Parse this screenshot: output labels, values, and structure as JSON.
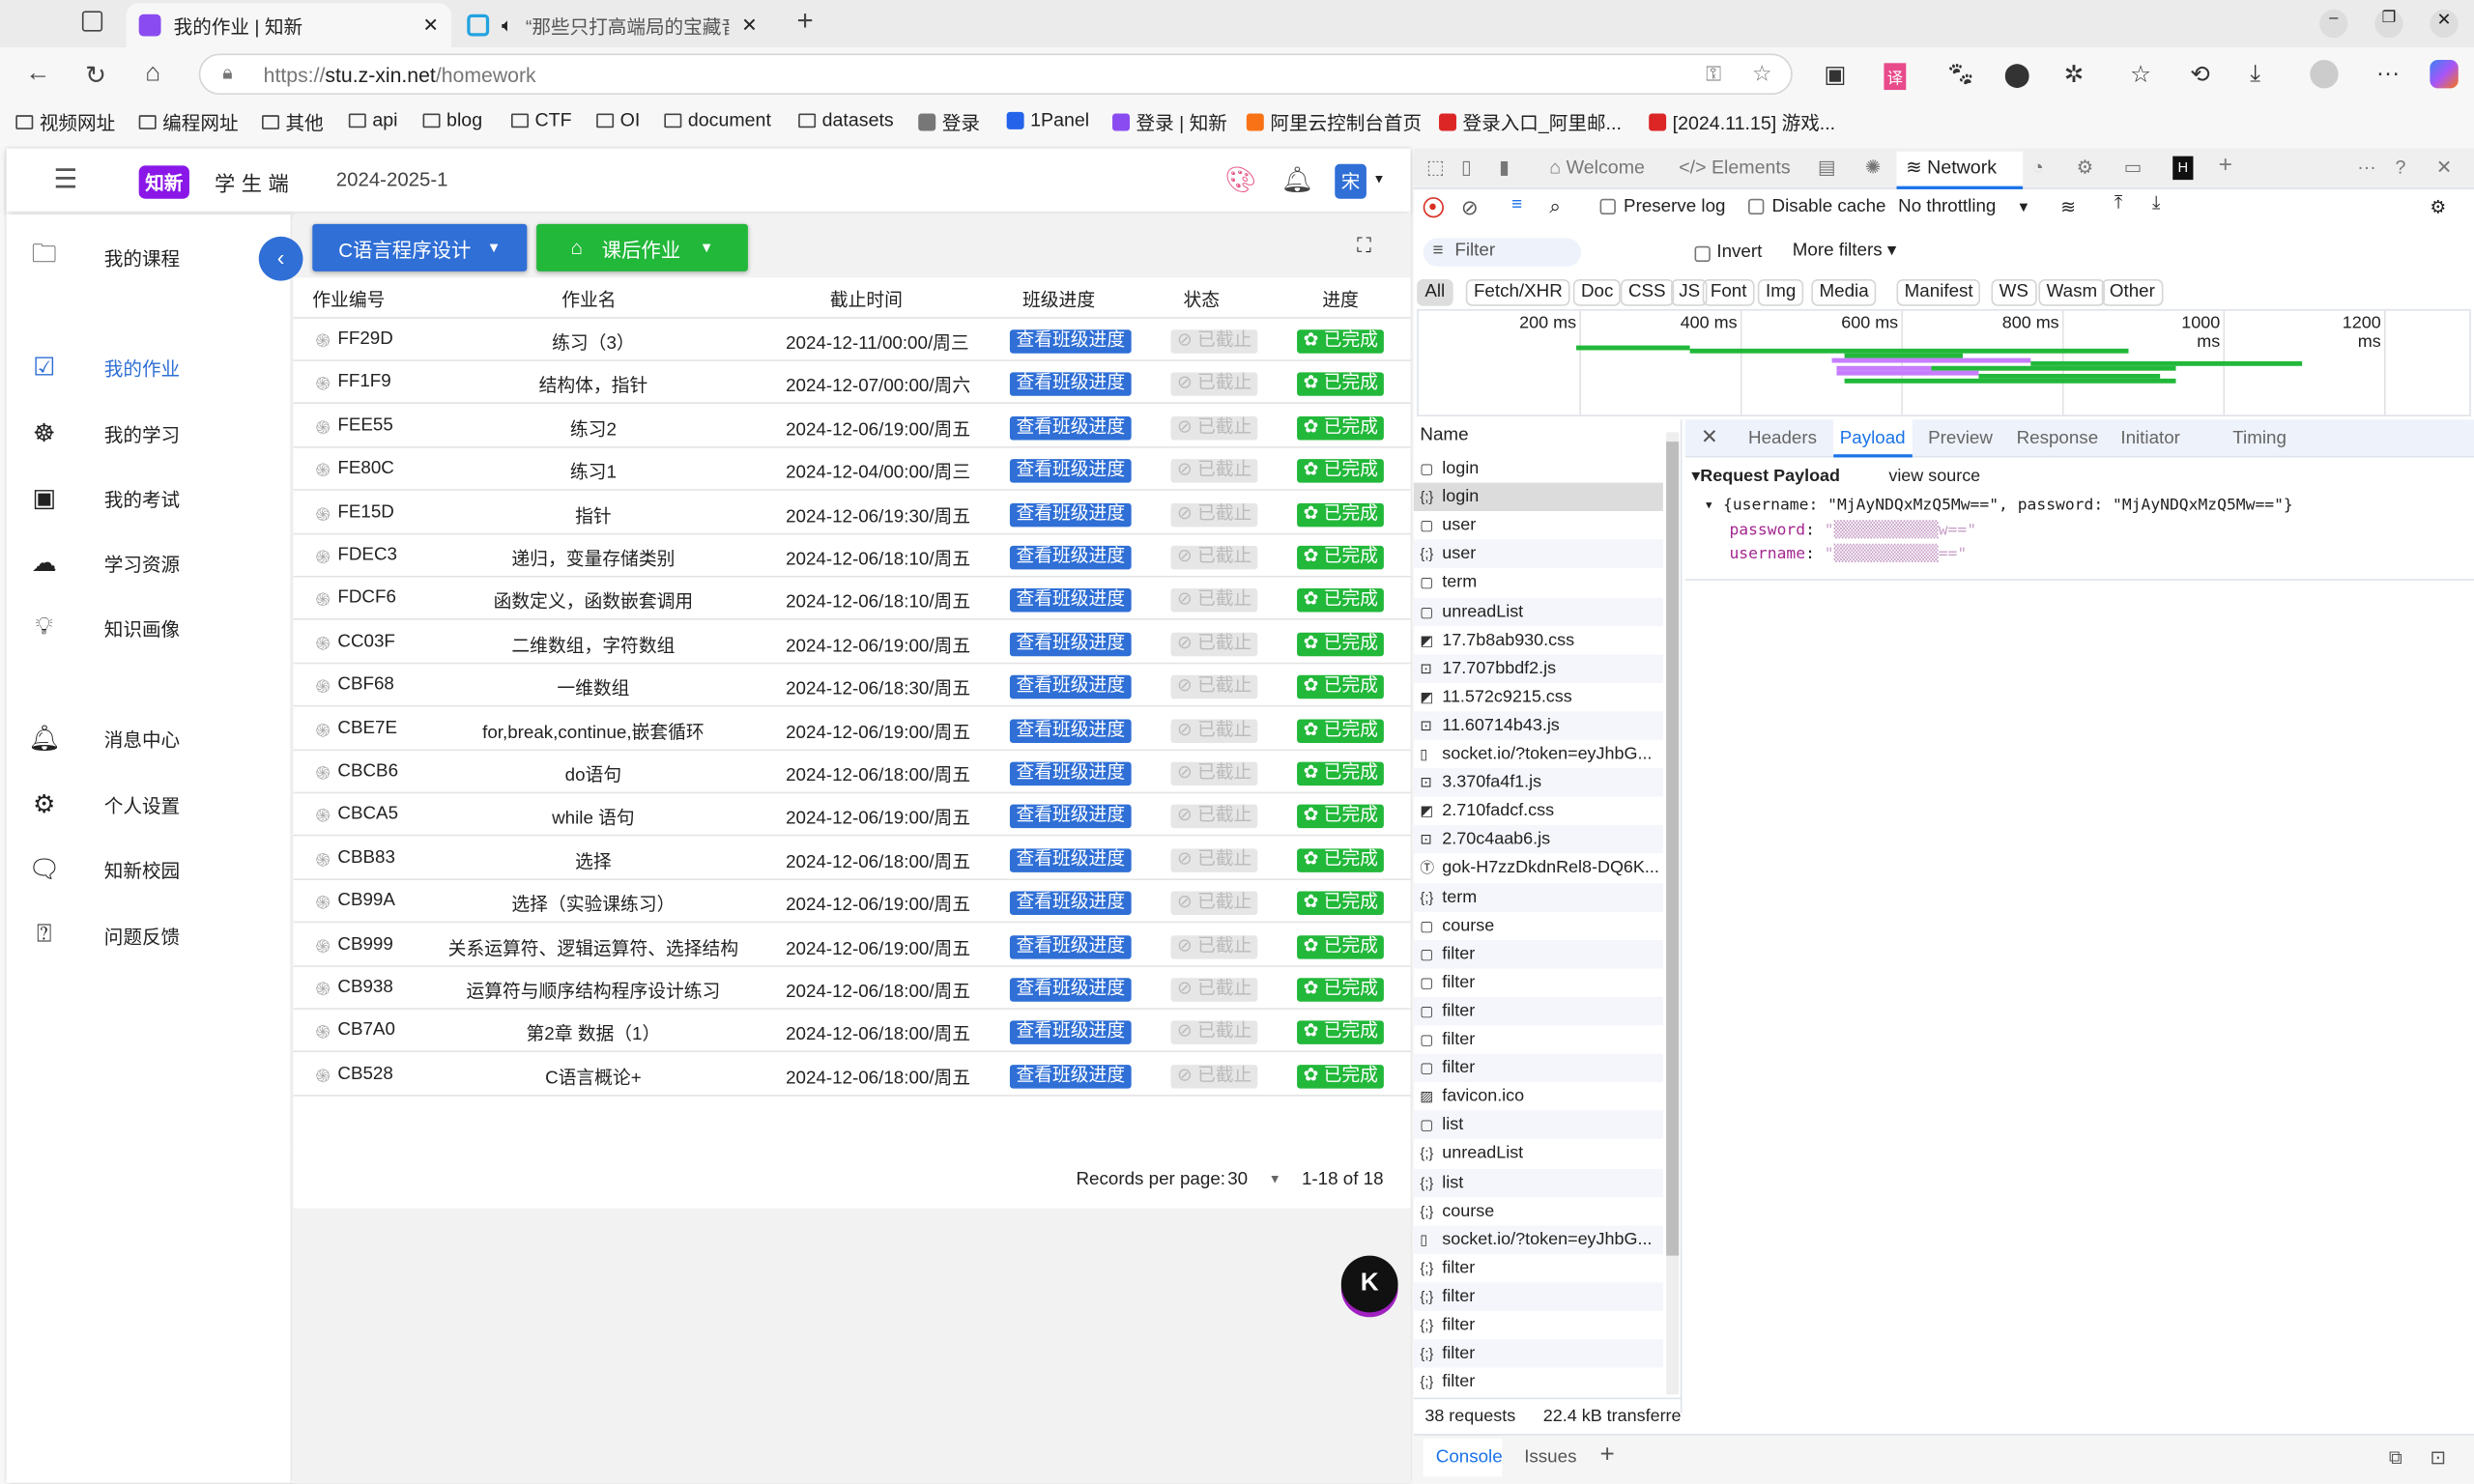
{
  "browser": {
    "tabs": [
      {
        "title": "我的作业 | 知新",
        "active": true
      },
      {
        "title": "“那些只打高端局的宝藏音",
        "active": false
      }
    ],
    "url_scheme": "https://",
    "url_host": "stu.z-xin.net",
    "url_path": "/homework",
    "bookmarks": [
      "视频网址",
      "编程网址",
      "其他",
      "api",
      "blog",
      "CTF",
      "OI",
      "document",
      "datasets",
      "登录",
      "1Panel",
      "登录 | 知新",
      "阿里云控制台首页",
      "登录入口_阿里邮...",
      "[2024.11.15] 游戏..."
    ]
  },
  "app": {
    "logo": "知新",
    "subtitle": "学生端",
    "term": "2024-2025-1",
    "avatar": "宋",
    "sidebar": [
      {
        "label": "我的课程",
        "icon": "folder-user-icon"
      },
      {
        "label": "我的作业",
        "icon": "checklist-icon",
        "selected": true
      },
      {
        "label": "我的学习",
        "icon": "brain-icon"
      },
      {
        "label": "我的考试",
        "icon": "exam-icon"
      },
      {
        "label": "学习资源",
        "icon": "cloud-icon"
      },
      {
        "label": "知识画像",
        "icon": "lightbulb-icon"
      },
      {
        "label": "消息中心",
        "icon": "bell-icon"
      },
      {
        "label": "个人设置",
        "icon": "gear-icon"
      },
      {
        "label": "知新校园",
        "icon": "chat-icon"
      },
      {
        "label": "问题反馈",
        "icon": "question-icon"
      }
    ],
    "course_select": "C语言程序设计",
    "type_select": "课后作业",
    "columns": [
      "作业编号",
      "作业名",
      "截止时间",
      "班级进度",
      "状态",
      "进度"
    ],
    "view_progress_label": "查看班级进度",
    "status_label": "已截止",
    "progress_label": "已完成",
    "rows": [
      [
        "FF29D",
        "练习（3）",
        "2024-12-11/00:00/周三"
      ],
      [
        "FF1F9",
        "结构体，指针",
        "2024-12-07/00:00/周六"
      ],
      [
        "FEE55",
        "练习2",
        "2024-12-06/19:00/周五"
      ],
      [
        "FE80C",
        "练习1",
        "2024-12-04/00:00/周三"
      ],
      [
        "FE15D",
        "指针",
        "2024-12-06/19:30/周五"
      ],
      [
        "FDEC3",
        "递归，变量存储类别",
        "2024-12-06/18:10/周五"
      ],
      [
        "FDCF6",
        "函数定义，函数嵌套调用",
        "2024-12-06/18:10/周五"
      ],
      [
        "CC03F",
        "二维数组，字符数组",
        "2024-12-06/19:00/周五"
      ],
      [
        "CBF68",
        "一维数组",
        "2024-12-06/18:30/周五"
      ],
      [
        "CBE7E",
        "for,break,continue,嵌套循环",
        "2024-12-06/19:00/周五"
      ],
      [
        "CBCB6",
        "do语句",
        "2024-12-06/18:00/周五"
      ],
      [
        "CBCA5",
        "while 语句",
        "2024-12-06/19:00/周五"
      ],
      [
        "CBB83",
        "选择",
        "2024-12-06/18:00/周五"
      ],
      [
        "CB99A",
        "选择（实验课练习）",
        "2024-12-06/19:00/周五"
      ],
      [
        "CB999",
        "关系运算符、逻辑运算符、选择结构",
        "2024-12-06/19:00/周五"
      ],
      [
        "CB938",
        "运算符与顺序结构程序设计练习",
        "2024-12-06/18:00/周五"
      ],
      [
        "CB7A0",
        "第2章 数据（1）",
        "2024-12-06/18:00/周五"
      ],
      [
        "CB528",
        "C语言概论+",
        "2024-12-06/18:00/周五"
      ]
    ],
    "records_per_page_label": "Records per page:",
    "records_per_page": "30",
    "range": "1-18 of 18"
  },
  "devtools": {
    "tabs": [
      "Welcome",
      "Elements",
      "Network"
    ],
    "preserve_log": "Preserve log",
    "disable_cache": "Disable cache",
    "throttling": "No throttling",
    "filter_placeholder": "Filter",
    "invert": "Invert",
    "more_filters": "More filters",
    "types": [
      "All",
      "Fetch/XHR",
      "Doc",
      "CSS",
      "JS",
      "Font",
      "Img",
      "Media",
      "Manifest",
      "WS",
      "Wasm",
      "Other"
    ],
    "timeline_ticks": [
      "200 ms",
      "400 ms",
      "600 ms",
      "800 ms",
      "1000 ms",
      "1200 ms"
    ],
    "name_header": "Name",
    "requests": [
      [
        "login",
        "doc"
      ],
      [
        "login",
        "fetch"
      ],
      [
        "user",
        "doc"
      ],
      [
        "user",
        "fetch"
      ],
      [
        "term",
        "doc"
      ],
      [
        "unreadList",
        "doc"
      ],
      [
        "17.7b8ab930.css",
        "css"
      ],
      [
        "17.707bbdf2.js",
        "js"
      ],
      [
        "11.572c9215.css",
        "css"
      ],
      [
        "11.60714b43.js",
        "js"
      ],
      [
        "socket.io/?token=eyJhbG...",
        "file"
      ],
      [
        "3.370fa4f1.js",
        "js"
      ],
      [
        "2.710fadcf.css",
        "css"
      ],
      [
        "2.70c4aab6.js",
        "js"
      ],
      [
        "gok-H7zzDkdnRel8-DQ6K...",
        "font"
      ],
      [
        "term",
        "fetch"
      ],
      [
        "course",
        "doc"
      ],
      [
        "filter",
        "doc"
      ],
      [
        "filter",
        "doc"
      ],
      [
        "filter",
        "doc"
      ],
      [
        "filter",
        "doc"
      ],
      [
        "filter",
        "doc"
      ],
      [
        "favicon.ico",
        "img"
      ],
      [
        "list",
        "doc"
      ],
      [
        "unreadList",
        "fetch"
      ],
      [
        "list",
        "fetch"
      ],
      [
        "course",
        "fetch"
      ],
      [
        "socket.io/?token=eyJhbG...",
        "file"
      ],
      [
        "filter",
        "fetch"
      ],
      [
        "filter",
        "fetch"
      ],
      [
        "filter",
        "fetch"
      ],
      [
        "filter",
        "fetch"
      ],
      [
        "filter",
        "fetch"
      ]
    ],
    "detail_tabs": [
      "Headers",
      "Payload",
      "Preview",
      "Response",
      "Initiator",
      "Timing"
    ],
    "payload_title": "Request Payload",
    "view_source": "view source",
    "payload_summary": "{username: \"MjAyNDQxMzQ5Mw==\", password: \"MjAyNDQxMzQ5Mw==\"}",
    "payload_fields": [
      {
        "key": "password",
        "value": "\"▒▒▒▒▒▒▒▒▒▒▒w==\""
      },
      {
        "key": "username",
        "value": "\"▒▒▒▒▒▒▒▒▒▒▒==\""
      }
    ],
    "requests_count": "38 requests",
    "transferred": "22.4 kB transferre",
    "drawer_tabs": [
      "Console",
      "Issues"
    ]
  },
  "colors": {
    "primary": "#2f6fd6",
    "success": "#22b83a",
    "brand": "#8a17e8",
    "devtools_accent": "#1a73e8"
  }
}
